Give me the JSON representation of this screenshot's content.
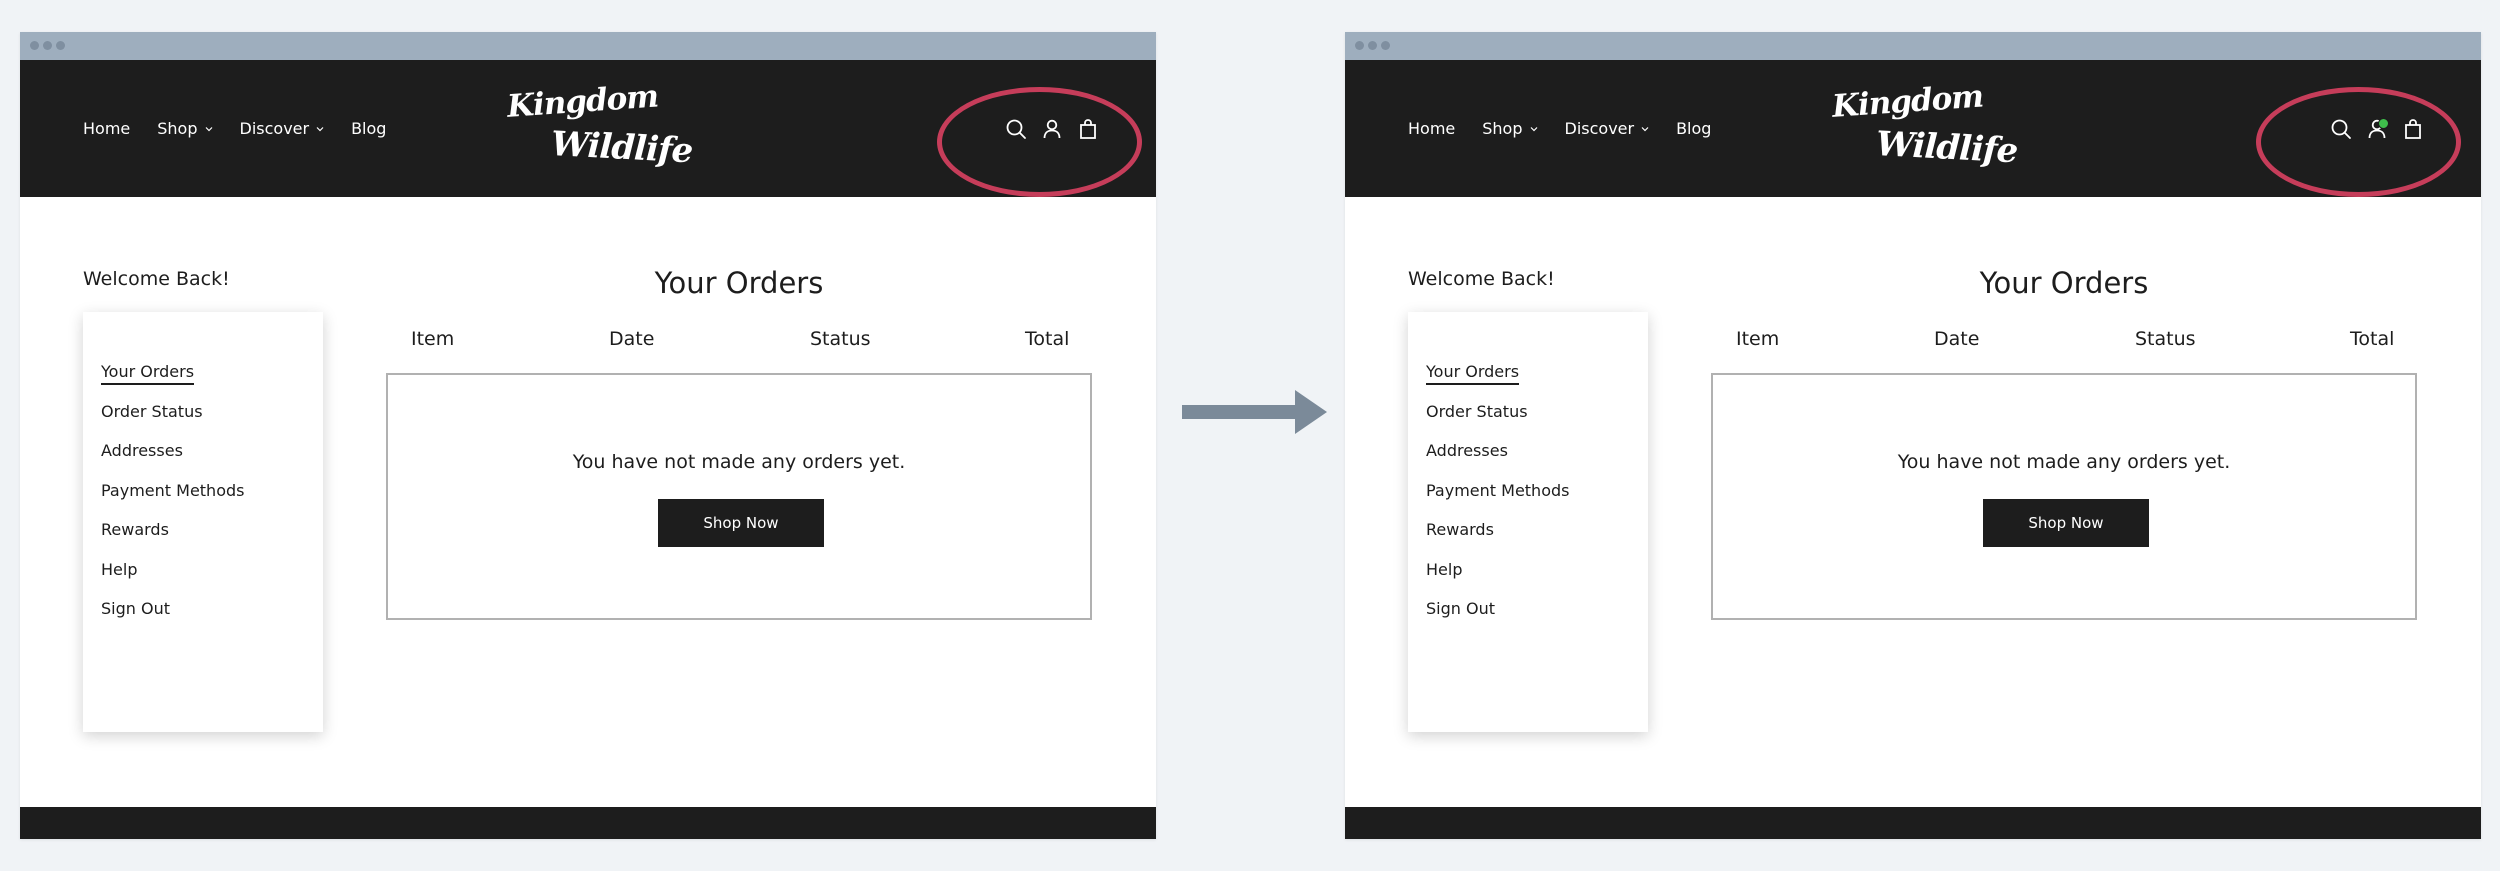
{
  "colors": {
    "header_bg": "#1d1d1d",
    "page_bg": "#f0f3f6",
    "highlight_ring": "#c63d5a",
    "notification_dot": "#3fbf4c",
    "arrow": "#7b8a99"
  },
  "nav": {
    "home": "Home",
    "shop": "Shop",
    "discover": "Discover",
    "blog": "Blog"
  },
  "logo": {
    "line1": "Kingdom",
    "line2": "Wildlife"
  },
  "header_icons": [
    "search-icon",
    "account-icon",
    "shopping-bag-icon"
  ],
  "account": {
    "welcome": "Welcome Back!",
    "menu": [
      "Your Orders",
      "Order Status",
      "Addresses",
      "Payment Methods",
      "Rewards",
      "Help",
      "Sign Out"
    ]
  },
  "orders": {
    "title": "Your Orders",
    "columns": [
      "Item",
      "Date",
      "Status",
      "Total"
    ],
    "empty_message": "You have not made any orders yet.",
    "cta": "Shop Now"
  }
}
